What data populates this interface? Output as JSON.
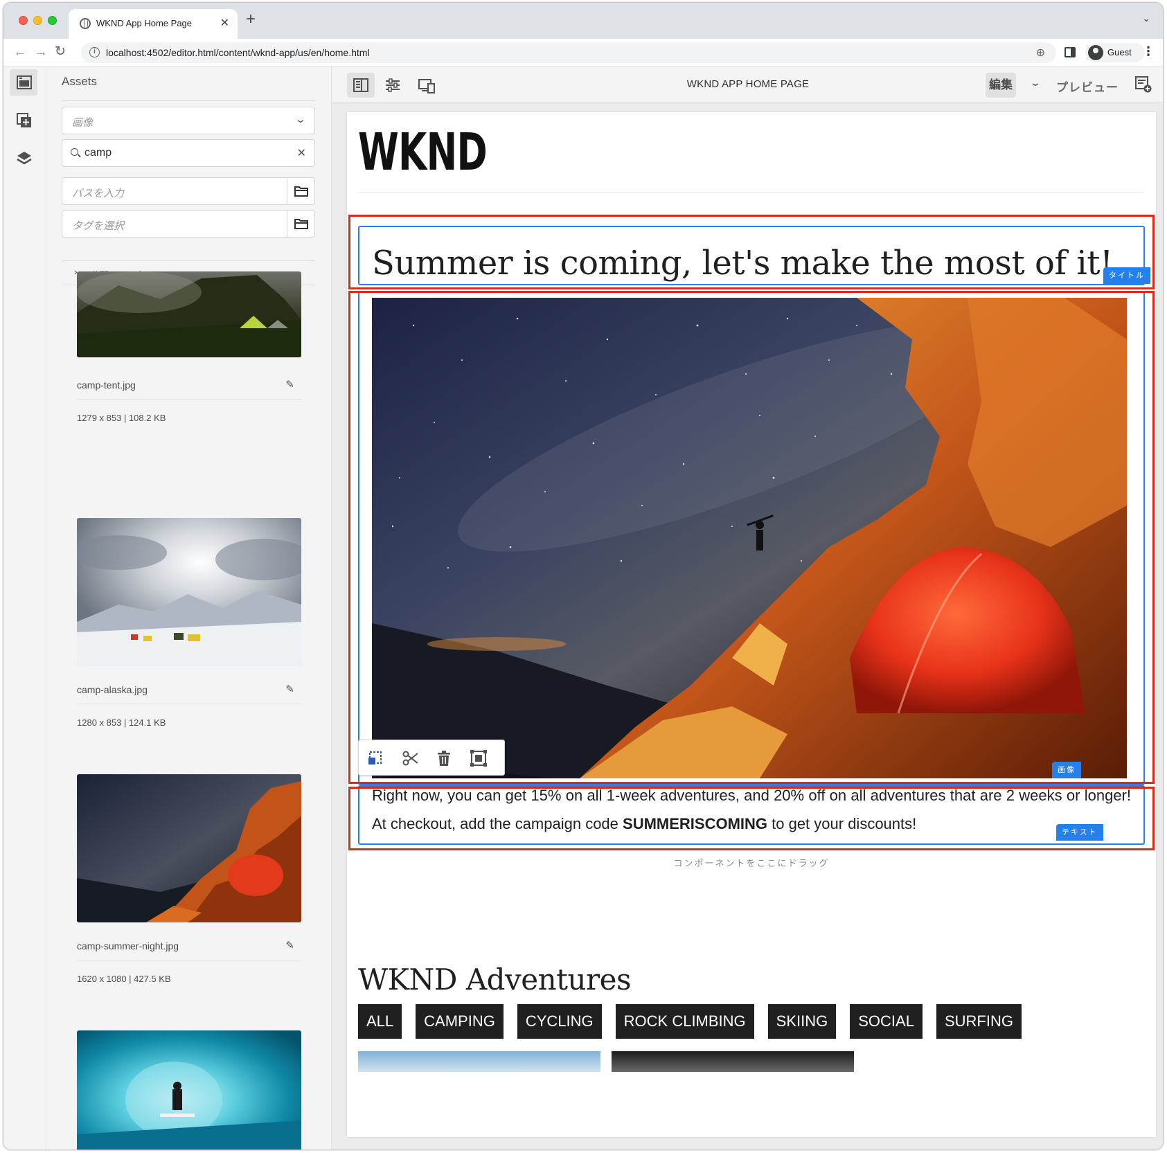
{
  "browser": {
    "tab_title": "WKND App Home Page",
    "url": "localhost:4502/editor.html/content/wknd-app/us/en/home.html",
    "profile_name": "Guest"
  },
  "assets_panel": {
    "title": "Assets",
    "type_filter": "画像",
    "search_value": "camp",
    "path_placeholder": "パスを入力",
    "tag_placeholder": "タグを選択",
    "publish_status_label": "公開ステータス",
    "items": [
      {
        "name": "camp-tent.jpg",
        "meta": "1279 x 853 | 108.2 KB"
      },
      {
        "name": "camp-alaska.jpg",
        "meta": "1280 x 853 | 124.1 KB"
      },
      {
        "name": "camp-summer-night.jpg",
        "meta": "1620 x 1080 | 427.5 KB"
      },
      {
        "name": "",
        "meta": ""
      }
    ]
  },
  "editor": {
    "page_title": "WKND APP HOME PAGE",
    "mode_edit": "編集",
    "mode_preview": "プレビュー"
  },
  "page": {
    "logo": "WKND",
    "hero_title": "Summer is coming, let's make the most of it!",
    "title_badge": "タイトル",
    "image_badge": "画像",
    "text_badge": "テキスト",
    "promo_before": "Right now, you can get 15% on all 1-week adventures, and 20% off on all adventures that are 2 weeks or longer! At checkout, add the campaign code ",
    "promo_code": "SUMMERISCOMING",
    "promo_after": " to get your discounts!",
    "drag_hint": "コンポーネントをここにドラッグ",
    "adventures_title": "WKND Adventures",
    "filters": [
      "ALL",
      "CAMPING",
      "CYCLING",
      "ROCK CLIMBING",
      "SKIING",
      "SOCIAL",
      "SURFING"
    ]
  },
  "colors": {
    "selection_blue": "#2680eb",
    "highlight_red": "#e32719",
    "panel_bg": "#f4f4f4"
  }
}
